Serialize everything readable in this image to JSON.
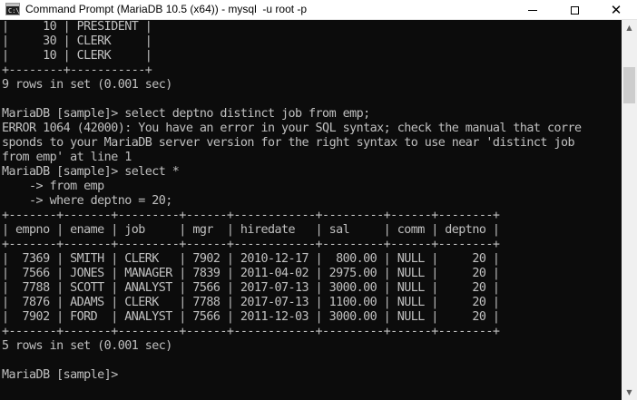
{
  "window": {
    "title": "Command Prompt (MariaDB 10.5 (x64)) - mysql  -u root -p",
    "icon": "C:\\",
    "minimize_icon": "minimize-icon",
    "maximize_icon": "maximize-icon",
    "close_icon": "close-icon"
  },
  "console": {
    "lines": [
      "|     10 | PRESIDENT |",
      "|     30 | CLERK     |",
      "|     10 | CLERK     |",
      "+--------+-----------+",
      "9 rows in set (0.001 sec)",
      "",
      "MariaDB [sample]> select deptno distinct job from emp;",
      "ERROR 1064 (42000): You have an error in your SQL syntax; check the manual that corre",
      "sponds to your MariaDB server version for the right syntax to use near 'distinct job",
      "from emp' at line 1",
      "MariaDB [sample]> select *",
      "    -> from emp",
      "    -> where deptno = 20;",
      "+-------+-------+---------+------+------------+---------+------+--------+",
      "| empno | ename | job     | mgr  | hiredate   | sal     | comm | deptno |",
      "+-------+-------+---------+------+------------+---------+------+--------+",
      "|  7369 | SMITH | CLERK   | 7902 | 2010-12-17 |  800.00 | NULL |     20 |",
      "|  7566 | JONES | MANAGER | 7839 | 2011-04-02 | 2975.00 | NULL |     20 |",
      "|  7788 | SCOTT | ANALYST | 7566 | 2017-07-13 | 3000.00 | NULL |     20 |",
      "|  7876 | ADAMS | CLERK   | 7788 | 2017-07-13 | 1100.00 | NULL |     20 |",
      "|  7902 | FORD  | ANALYST | 7566 | 2011-12-03 | 3000.00 | NULL |     20 |",
      "+-------+-------+---------+------+------------+---------+------+--------+",
      "5 rows in set (0.001 sec)",
      "",
      "MariaDB [sample]> "
    ]
  },
  "scrollbar": {
    "up_icon": "scroll-up-arrow-icon",
    "down_icon": "scroll-down-arrow-icon"
  },
  "colors": {
    "console_background": "#0c0c0c",
    "console_text": "#c0c0c0",
    "titlebar": "#ffffff"
  }
}
